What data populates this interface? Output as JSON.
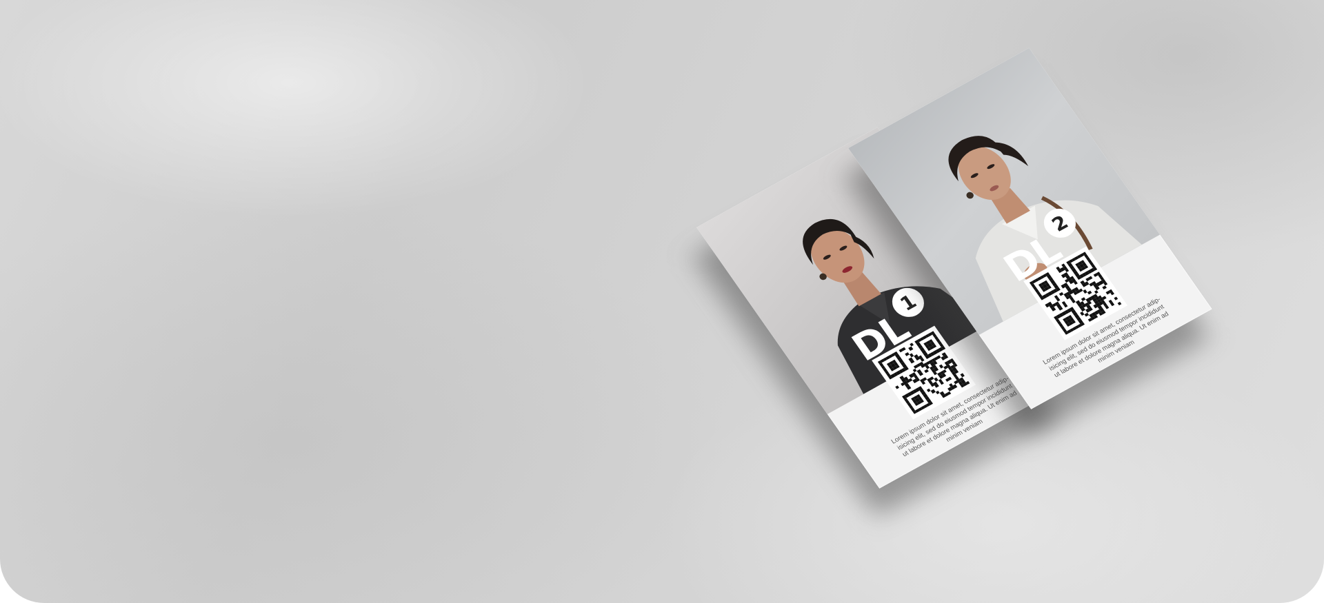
{
  "flyers": [
    {
      "logo_text": "DL",
      "badge_number": "1",
      "caption": "Lorem ipsum dolor sit amet, consectetur adip-\nisicing elit, sed do eiusmod tempor incididunt\nut labore et dolore magna aliqua. Ut enim ad\nminim veniam"
    },
    {
      "logo_text": "DL",
      "badge_number": "2",
      "caption": "Lorem ipsum dolor sit amet, consectetur adip-\nisicing elit, sed do eiusmod tempor incididunt\nut labore et dolore magna aliqua. Ut enim ad\nminim veniam"
    }
  ],
  "colors": {
    "background": "#d6d6d6",
    "paper": "#f3f3f3",
    "logo": "#ffffff",
    "qr": "#111111"
  }
}
